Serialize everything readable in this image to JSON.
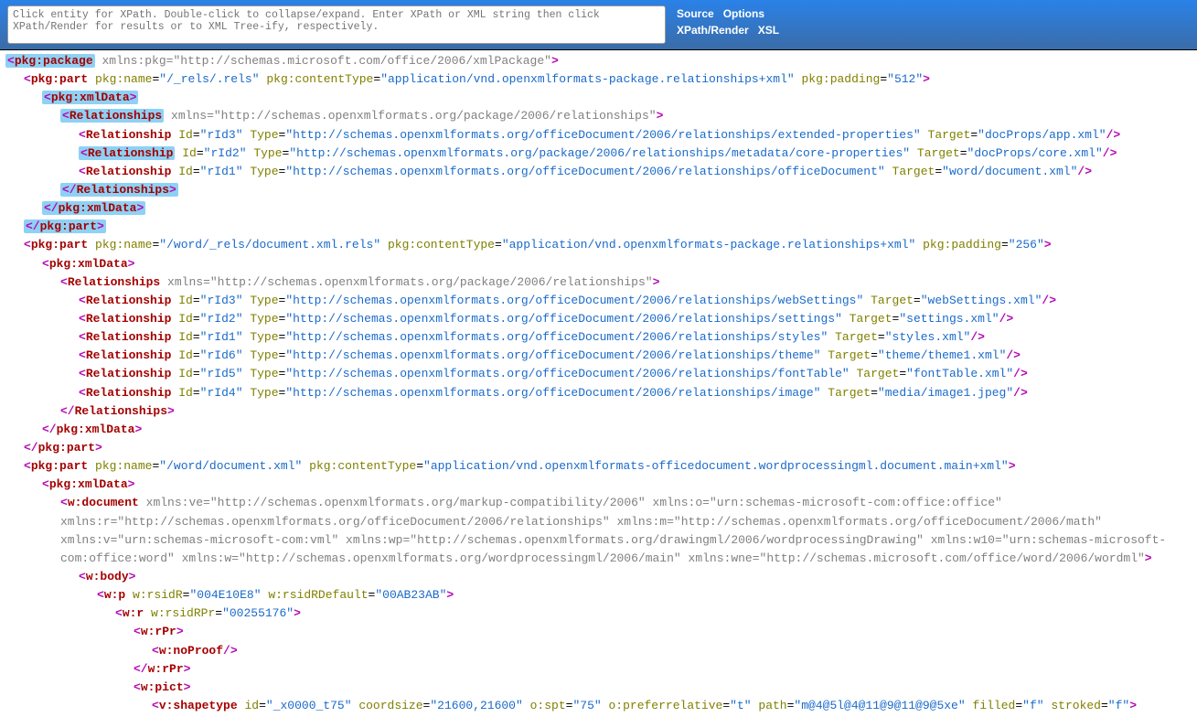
{
  "header": {
    "placeholder": "Click entity for XPath. Double-click to collapse/expand. Enter XPath or XML string then click XPath/Render for results or to XML Tree-ify, respectively.",
    "links": {
      "source": "Source",
      "options": "Options",
      "xpath": "XPath/Render",
      "xsl": "XSL"
    }
  },
  "xml": {
    "pkg_package": "pkg:package",
    "pkg_part": "pkg:part",
    "pkg_xmlData": "pkg:xmlData",
    "relationships": "Relationships",
    "relationship": "Relationship",
    "w_document": "w:document",
    "w_body": "w:body",
    "w_p": "w:p",
    "w_r": "w:r",
    "w_rPr": "w:rPr",
    "w_noProof": "w:noProof",
    "w_pict": "w:pict",
    "v_shapetype": "v:shapetype",
    "xmlns_pkg": "xmlns:pkg",
    "pkg_name": "pkg:name",
    "pkg_contentType": "pkg:contentType",
    "pkg_padding": "pkg:padding",
    "xmlns_attr": "xmlns",
    "id_attr": "Id",
    "type_attr": "Type",
    "target_attr": "Target",
    "rsid_r": "w:rsidR",
    "rsid_def": "w:rsidRDefault",
    "rsid_rpr": "w:rsidRPr",
    "st_id": "id",
    "coordsize": "coordsize",
    "ospt": "o:spt",
    "opref": "o:preferrelative",
    "path_attr": "path",
    "filled": "filled",
    "stroked": "stroked",
    "pkg_ns_val": "http://schemas.microsoft.com/office/2006/xmlPackage",
    "rels_ns": "http://schemas.openxmlformats.org/package/2006/relationships",
    "part1_name": "/_rels/.rels",
    "part1_ct": "application/vnd.openxmlformats-package.relationships+xml",
    "part1_pad": "512",
    "p1_r1_id": "rId3",
    "p1_r1_type": "http://schemas.openxmlformats.org/officeDocument/2006/relationships/extended-properties",
    "p1_r1_target": "docProps/app.xml",
    "p1_r2_id": "rId2",
    "p1_r2_type": "http://schemas.openxmlformats.org/package/2006/relationships/metadata/core-properties",
    "p1_r2_target": "docProps/core.xml",
    "p1_r3_id": "rId1",
    "p1_r3_type": "http://schemas.openxmlformats.org/officeDocument/2006/relationships/officeDocument",
    "p1_r3_target": "word/document.xml",
    "part2_name": "/word/_rels/document.xml.rels",
    "part2_ct": "application/vnd.openxmlformats-package.relationships+xml",
    "part2_pad": "256",
    "p2_r1_id": "rId3",
    "p2_r1_type": "http://schemas.openxmlformats.org/officeDocument/2006/relationships/webSettings",
    "p2_r1_target": "webSettings.xml",
    "p2_r2_id": "rId2",
    "p2_r2_type": "http://schemas.openxmlformats.org/officeDocument/2006/relationships/settings",
    "p2_r2_target": "settings.xml",
    "p2_r3_id": "rId1",
    "p2_r3_type": "http://schemas.openxmlformats.org/officeDocument/2006/relationships/styles",
    "p2_r3_target": "styles.xml",
    "p2_r4_id": "rId6",
    "p2_r4_type": "http://schemas.openxmlformats.org/officeDocument/2006/relationships/theme",
    "p2_r4_target": "theme/theme1.xml",
    "p2_r5_id": "rId5",
    "p2_r5_type": "http://schemas.openxmlformats.org/officeDocument/2006/relationships/fontTable",
    "p2_r5_target": "fontTable.xml",
    "p2_r6_id": "rId4",
    "p2_r6_type": "http://schemas.openxmlformats.org/officeDocument/2006/relationships/image",
    "p2_r6_target": "media/image1.jpeg",
    "part3_name": "/word/document.xml",
    "part3_ct": "application/vnd.openxmlformats-officedocument.wordprocessingml.document.main+xml",
    "doc_ns": "xmlns:ve=\"http://schemas.openxmlformats.org/markup-compatibility/2006\" xmlns:o=\"urn:schemas-microsoft-com:office:office\" xmlns:r=\"http://schemas.openxmlformats.org/officeDocument/2006/relationships\" xmlns:m=\"http://schemas.openxmlformats.org/officeDocument/2006/math\" xmlns:v=\"urn:schemas-microsoft-com:vml\" xmlns:wp=\"http://schemas.openxmlformats.org/drawingml/2006/wordprocessingDrawing\" xmlns:w10=\"urn:schemas-microsoft-com:office:word\" xmlns:w=\"http://schemas.openxmlformats.org/wordprocessingml/2006/main\" xmlns:wne=\"http://schemas.microsoft.com/office/word/2006/wordml\"",
    "wp_rsid": "004E10E8",
    "wp_rsid_def": "00AB23AB",
    "wr_rsid": "00255176",
    "vst_id": "_x0000_t75",
    "vst_coord": "21600,21600",
    "vst_spt": "75",
    "vst_pref": "t",
    "vst_path": "m@4@5l@4@11@9@11@9@5xe",
    "vst_filled": "f",
    "vst_stroked": "f"
  }
}
